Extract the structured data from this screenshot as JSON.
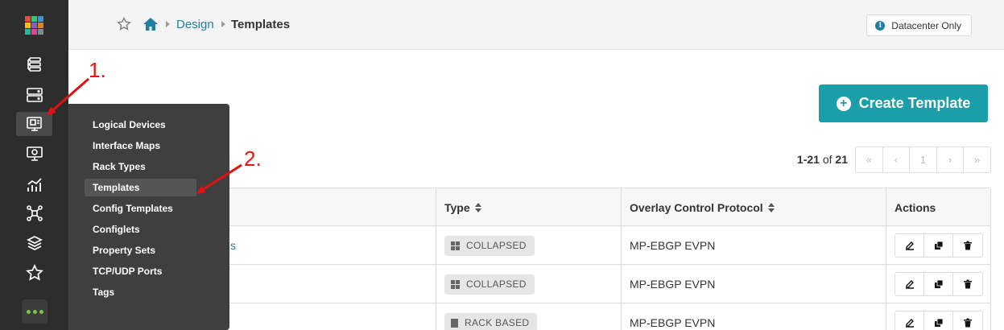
{
  "sidebar": {
    "logo_colors": [
      "#e74c3c",
      "#2ecc71",
      "#3498db",
      "#f1c40f",
      "#9b59b6",
      "#e67e22",
      "#1abc9c",
      "#e84393",
      "#7f8c8d"
    ],
    "icons": [
      {
        "name": "devices-icon",
        "active": false
      },
      {
        "name": "servers-icon",
        "active": false
      },
      {
        "name": "design-icon",
        "active": true
      },
      {
        "name": "monitor-icon",
        "active": false
      },
      {
        "name": "analytics-icon",
        "active": false
      },
      {
        "name": "topology-icon",
        "active": false
      },
      {
        "name": "layers-icon",
        "active": false
      },
      {
        "name": "favorites-icon",
        "active": false
      }
    ],
    "more_icon": "more-icon"
  },
  "header": {
    "breadcrumb": {
      "home_icon": "home-icon",
      "link": "Design",
      "current": "Templates"
    },
    "badge": {
      "icon": "info-icon",
      "label": "Datacenter Only"
    }
  },
  "flyout": {
    "items": [
      "Logical Devices",
      "Interface Maps",
      "Rack Types",
      "Templates",
      "Config Templates",
      "Configlets",
      "Property Sets",
      "TCP/UDP Ports",
      "Tags"
    ],
    "hovered_index": 3
  },
  "toolbar": {
    "create_label": "Create Template"
  },
  "pagination": {
    "range": "1-21",
    "of_label": "of",
    "total": "21",
    "current_page": "1",
    "first": "«",
    "prev": "‹",
    "next": "›",
    "last": "»"
  },
  "table": {
    "headers": {
      "type": "Type",
      "overlay": "Overlay Control Protocol",
      "actions": "Actions"
    },
    "rows": [
      {
        "name_fragment": "s",
        "type": "COLLAPSED",
        "type_icon": "grid-icon",
        "overlay": "MP-EBGP EVPN"
      },
      {
        "name_fragment": "",
        "type": "COLLAPSED",
        "type_icon": "grid-icon",
        "overlay": "MP-EBGP EVPN"
      },
      {
        "name_fragment": "",
        "type": "RACK BASED",
        "type_icon": "building-icon",
        "overlay": "MP-EBGP EVPN"
      }
    ]
  },
  "annotations": {
    "step1": "1.",
    "step2": "2.",
    "arrow_color": "#e11111"
  }
}
